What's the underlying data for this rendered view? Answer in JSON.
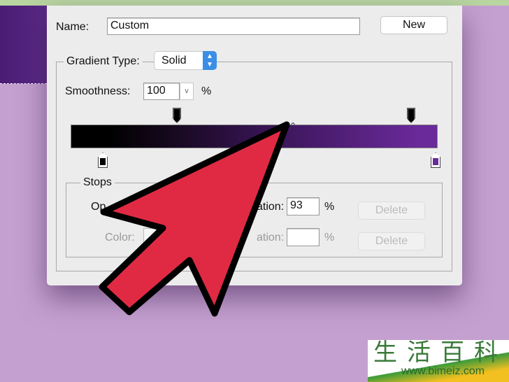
{
  "name": {
    "label": "Name:",
    "value": "Custom"
  },
  "new_button": "New",
  "gradient_type": {
    "label": "Gradient Type:",
    "value": "Solid"
  },
  "smoothness": {
    "label": "Smoothness:",
    "value": "100",
    "unit": "%"
  },
  "gradient": {
    "colors": [
      "#000000",
      "#6a2a9a"
    ]
  },
  "stops": {
    "title": "Stops",
    "opacity_label": "Op",
    "opacity_location_label": "ation:",
    "opacity_location": "93",
    "unit": "%",
    "color_label": "Color:",
    "color_location_label": "ation:",
    "color_location": "",
    "delete": "Delete"
  },
  "watermark": {
    "chars": "生活百科",
    "url": "www.bimeiz.com"
  },
  "colors": {
    "arrow": "#e02a44",
    "accent": "#3a8ee6"
  }
}
